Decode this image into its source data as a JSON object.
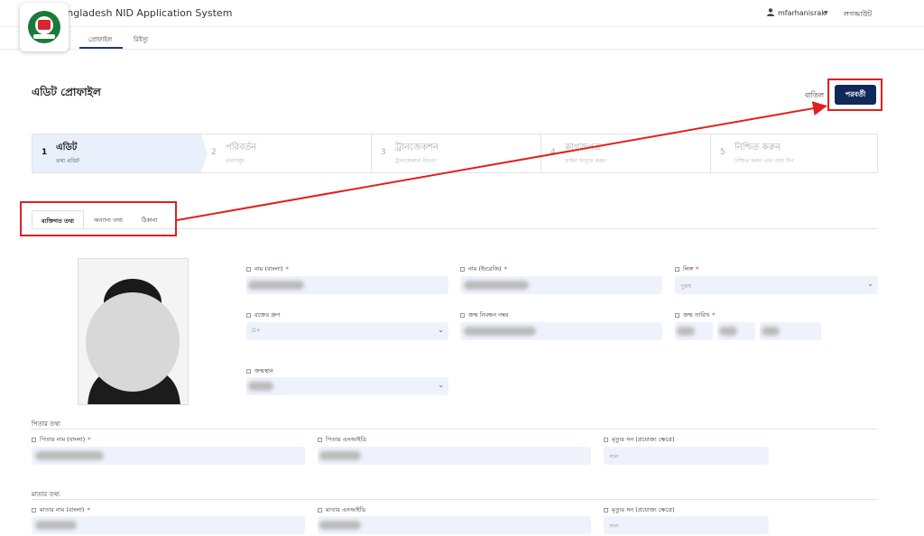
{
  "header": {
    "app_title": "Bangladesh NID Application System",
    "username": "mfarhanisrak",
    "logout": "লগআউট"
  },
  "nav": {
    "tabs": [
      {
        "label": "প্রোফাইল",
        "active": true
      },
      {
        "label": "রিইস্যু",
        "active": false
      }
    ]
  },
  "page": {
    "title": "এডিট প্রোফাইল",
    "cancel_label": "বাতিল",
    "next_label": "পরবর্তী"
  },
  "stepper": {
    "steps": [
      {
        "num": "1",
        "title": "এডিট",
        "sub": "তথ্য এডিট",
        "active": true
      },
      {
        "num": "2",
        "title": "পরিবর্তন",
        "sub": "তথ্যসমূহ",
        "active": false
      },
      {
        "num": "3",
        "title": "ট্রানজেকশন",
        "sub": "ট্রানজেকশন বিবরণ",
        "active": false
      },
      {
        "num": "4",
        "title": "কাগজপত্র",
        "sub": "ফাইল সংযুক্ত করুন",
        "active": false
      },
      {
        "num": "5",
        "title": "নিশ্চিত করুন",
        "sub": "নিশ্চিত করুন এবং জমা দিন",
        "active": false
      }
    ]
  },
  "subtabs": [
    {
      "label": "ব্যক্তিগত তথ্য",
      "active": true
    },
    {
      "label": "অন্যান্য তথ্য",
      "active": false
    },
    {
      "label": "ঠিকানা",
      "active": false
    }
  ],
  "fields": {
    "name_bn": {
      "label": "নাম (বাংলা)",
      "required": true
    },
    "name_en": {
      "label": "নাম (ইংরেজি)",
      "required": true
    },
    "gender": {
      "label": "লিঙ্গ",
      "required": true,
      "value": "পুরুষ"
    },
    "blood_group": {
      "label": "রক্তের গ্রুপ",
      "value": "O+"
    },
    "birth_reg_no": {
      "label": "জন্ম নিবন্ধন নম্বর"
    },
    "birth_date": {
      "label": "জন্ম তারিখ",
      "required": true
    },
    "birth_place": {
      "label": "জন্মস্থান"
    }
  },
  "father": {
    "section_title": "পিতার তথ্য",
    "name_label": "পিতার নাম (বাংলা)",
    "nid_label": "পিতার এনআইডি",
    "death_label": "মৃত্যুর সন (প্রযোজ্য ক্ষেত্রে)",
    "death_placeholder": "সাল"
  },
  "mother": {
    "section_title": "মাতার তথ্য",
    "name_label": "মাতার নাম (বাংলা)",
    "nid_label": "মাতার এনআইডি",
    "death_label": "মৃত্যুর সন (প্রযোজ্য ক্ষেত্রে)",
    "death_placeholder": "সাল"
  },
  "colors": {
    "primary": "#12285a",
    "highlight": "#e02020",
    "input_bg": "#eef3fb"
  }
}
